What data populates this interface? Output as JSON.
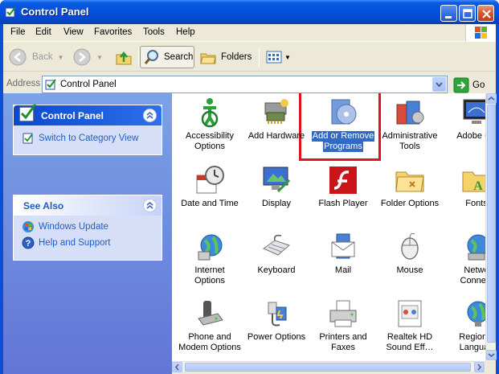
{
  "window": {
    "title": "Control Panel"
  },
  "menubar": {
    "items": [
      "File",
      "Edit",
      "View",
      "Favorites",
      "Tools",
      "Help"
    ]
  },
  "toolbar": {
    "back_label": "Back",
    "search_label": "Search",
    "folders_label": "Folders"
  },
  "address": {
    "label": "Address",
    "value": "Control Panel",
    "go_label": "Go"
  },
  "sidebar": {
    "panel1": {
      "title": "Control Panel",
      "link": "Switch to Category View"
    },
    "panel2": {
      "title": "See Also",
      "links": [
        "Windows Update",
        "Help and Support"
      ]
    }
  },
  "items": [
    {
      "label": "Accessibility Options",
      "line1": "Accessibility",
      "line2": "Options",
      "icon": "accessibility-icon"
    },
    {
      "label": "Add Hardware",
      "line1": "Add Hardware",
      "line2": "",
      "icon": "add-hardware-icon"
    },
    {
      "label": "Add or Remove Programs",
      "line1": "Add or Remove",
      "line2": "Programs",
      "icon": "add-remove-programs-icon",
      "selected": true
    },
    {
      "label": "Administrative Tools",
      "line1": "Administrative",
      "line2": "Tools",
      "icon": "administrative-tools-icon"
    },
    {
      "label": "Adobe Ga",
      "line1": "Adobe Ga",
      "line2": "",
      "icon": "adobe-gamma-icon"
    },
    {
      "label": "Date and Time",
      "line1": "Date and Time",
      "line2": "",
      "icon": "date-time-icon"
    },
    {
      "label": "Display",
      "line1": "Display",
      "line2": "",
      "icon": "display-icon"
    },
    {
      "label": "Flash Player",
      "line1": "Flash Player",
      "line2": "",
      "icon": "flash-player-icon"
    },
    {
      "label": "Folder Options",
      "line1": "Folder Options",
      "line2": "",
      "icon": "folder-options-icon"
    },
    {
      "label": "Fonts",
      "line1": "Fonts",
      "line2": "",
      "icon": "fonts-icon"
    },
    {
      "label": "Internet Options",
      "line1": "Internet",
      "line2": "Options",
      "icon": "internet-options-icon"
    },
    {
      "label": "Keyboard",
      "line1": "Keyboard",
      "line2": "",
      "icon": "keyboard-icon"
    },
    {
      "label": "Mail",
      "line1": "Mail",
      "line2": "",
      "icon": "mail-icon"
    },
    {
      "label": "Mouse",
      "line1": "Mouse",
      "line2": "",
      "icon": "mouse-icon"
    },
    {
      "label": "Network Connections",
      "line1": "Netwo",
      "line2": "Connect",
      "icon": "network-icon"
    },
    {
      "label": "Phone and Modem Options",
      "line1": "Phone and",
      "line2": "Modem Options",
      "icon": "phone-modem-icon"
    },
    {
      "label": "Power Options",
      "line1": "Power Options",
      "line2": "",
      "icon": "power-options-icon"
    },
    {
      "label": "Printers and Faxes",
      "line1": "Printers and",
      "line2": "Faxes",
      "icon": "printers-faxes-icon"
    },
    {
      "label": "Realtek HD Sound Effect Manager",
      "line1": "Realtek HD",
      "line2": "Sound Eff…",
      "icon": "realtek-sound-icon"
    },
    {
      "label": "Regional and Language Options",
      "line1": "Regional",
      "line2": "Languag",
      "icon": "regional-language-icon"
    }
  ],
  "colors": {
    "titlebar": "#0550dc",
    "selection": "#316ac5",
    "highlight_border": "#e0141e",
    "link": "#215dc6"
  }
}
